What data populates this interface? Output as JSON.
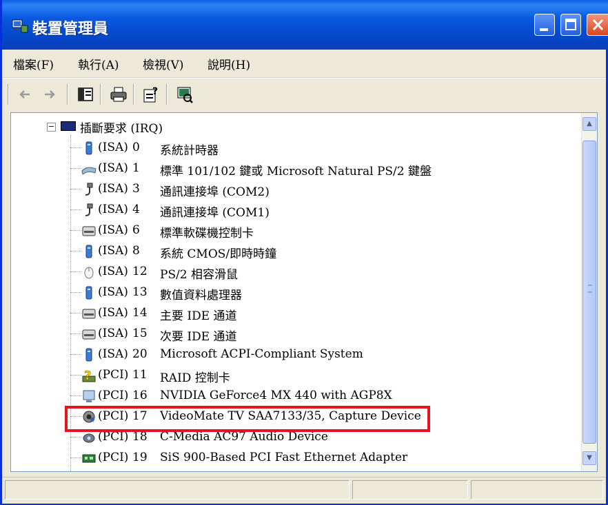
{
  "window": {
    "title": "裝置管理員"
  },
  "menu": [
    "檔案(F)",
    "執行(A)",
    "檢視(V)",
    "說明(H)"
  ],
  "tree": {
    "root_label": "插斷要求 (IRQ)",
    "items": [
      {
        "bus": "(ISA)",
        "irq": "0",
        "name": "系統計時器",
        "icon": "system-device-icon"
      },
      {
        "bus": "(ISA)",
        "irq": "1",
        "name": "標準 101/102 鍵或 Microsoft Natural PS/2 鍵盤",
        "icon": "keyboard-icon"
      },
      {
        "bus": "(ISA)",
        "irq": "3",
        "name": "通訊連接埠 (COM2)",
        "icon": "port-icon"
      },
      {
        "bus": "(ISA)",
        "irq": "4",
        "name": "通訊連接埠 (COM1)",
        "icon": "port-icon"
      },
      {
        "bus": "(ISA)",
        "irq": "6",
        "name": "標準軟碟機控制卡",
        "icon": "disk-controller-icon"
      },
      {
        "bus": "(ISA)",
        "irq": "8",
        "name": "系統 CMOS/即時時鐘",
        "icon": "system-device-icon"
      },
      {
        "bus": "(ISA)",
        "irq": "12",
        "name": "PS/2 相容滑鼠",
        "icon": "mouse-icon"
      },
      {
        "bus": "(ISA)",
        "irq": "13",
        "name": "數值資料處理器",
        "icon": "system-device-icon"
      },
      {
        "bus": "(ISA)",
        "irq": "14",
        "name": "主要 IDE 通道",
        "icon": "disk-controller-icon"
      },
      {
        "bus": "(ISA)",
        "irq": "15",
        "name": "次要 IDE 通道",
        "icon": "disk-controller-icon"
      },
      {
        "bus": "(ISA)",
        "irq": "20",
        "name": "Microsoft ACPI-Compliant System",
        "icon": "system-device-icon"
      },
      {
        "bus": "(PCI)",
        "irq": "11",
        "name": "RAID 控制卡",
        "icon": "unknown-device-icon"
      },
      {
        "bus": "(PCI)",
        "irq": "16",
        "name": "NVIDIA GeForce4 MX 440 with AGP8X",
        "icon": "display-adapter-icon"
      },
      {
        "bus": "(PCI)",
        "irq": "17",
        "name": "VideoMate TV SAA7133/35, Capture Device",
        "icon": "capture-device-icon"
      },
      {
        "bus": "(PCI)",
        "irq": "18",
        "name": "C-Media AC97 Audio Device",
        "icon": "audio-device-icon"
      },
      {
        "bus": "(PCI)",
        "irq": "19",
        "name": "SiS 900-Based PCI Fast Ethernet Adapter",
        "icon": "network-adapter-icon"
      }
    ]
  },
  "highlight": {
    "item_index": 13,
    "color": "#e8121e"
  },
  "colors": {
    "titlebar": "#0a5ae0",
    "chrome": "#ece9d8",
    "close_button": "#d9461f"
  }
}
